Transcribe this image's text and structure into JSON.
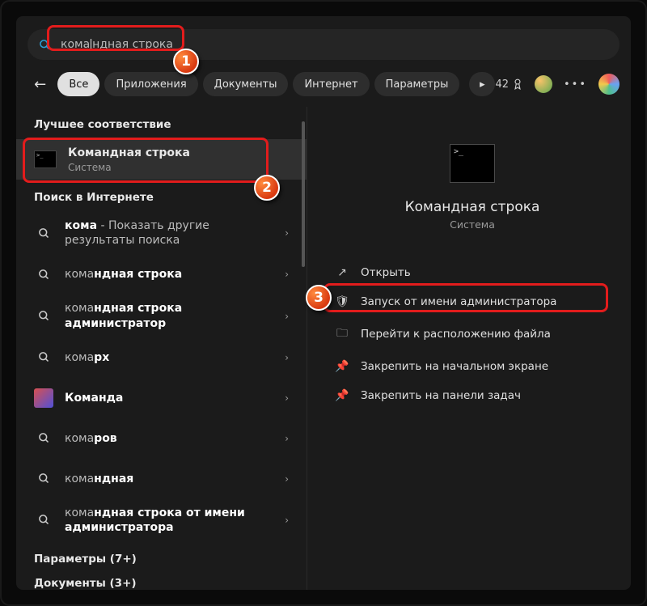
{
  "search": {
    "query_prefix": "кома",
    "query_suffix": "ндная строка"
  },
  "nav": {
    "tabs": [
      "Все",
      "Приложения",
      "Документы",
      "Интернет",
      "Параметры"
    ],
    "points": "42"
  },
  "left": {
    "best_match_heading": "Лучшее соответствие",
    "best": {
      "title": "Командная строка",
      "subtitle": "Система"
    },
    "web_heading": "Поиск в Интернете",
    "web": [
      {
        "pre": "кома",
        "bold": "",
        "rest": " - Показать другие результаты поиска"
      },
      {
        "pre": "кома",
        "bold": "ндная строка",
        "rest": ""
      },
      {
        "pre": "кома",
        "bold": "ндная строка администратор",
        "rest": ""
      },
      {
        "pre": "кома",
        "bold": "рх",
        "rest": ""
      },
      {
        "pre": "",
        "bold": "Команда",
        "rest": "",
        "team": true
      },
      {
        "pre": "кома",
        "bold": "ров",
        "rest": ""
      },
      {
        "pre": "кома",
        "bold": "ндная",
        "rest": ""
      },
      {
        "pre": "кома",
        "bold": "ндная строка от имени администратора",
        "rest": ""
      }
    ],
    "settings_heading": "Параметры (7+)",
    "documents_heading": "Документы (3+)"
  },
  "right": {
    "app_name": "Командная строка",
    "app_category": "Система",
    "actions": [
      {
        "icon": "open",
        "label": "Открыть"
      },
      {
        "icon": "admin",
        "label": "Запуск от имени администратора"
      },
      {
        "icon": "folder",
        "label": "Перейти к расположению файла"
      },
      {
        "icon": "pin",
        "label": "Закрепить на начальном экране"
      },
      {
        "icon": "pin",
        "label": "Закрепить на панели задач"
      }
    ]
  },
  "markers": {
    "m1": "1",
    "m2": "2",
    "m3": "3"
  }
}
